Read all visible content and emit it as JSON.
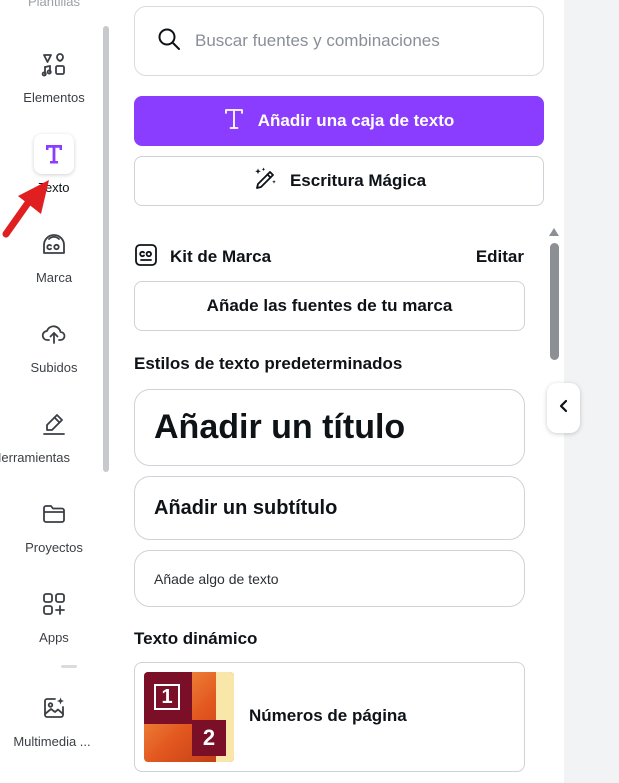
{
  "sidebar": {
    "top_partial_label": "Plantillas",
    "items": [
      {
        "label": "Elementos",
        "icon": "elements-icon"
      },
      {
        "label": "Texto",
        "icon": "text-icon"
      },
      {
        "label": "Marca",
        "icon": "brand-icon"
      },
      {
        "label": "Subidos",
        "icon": "upload-cloud-icon"
      },
      {
        "label": "Herramientas",
        "icon": "draw-tool-icon"
      },
      {
        "label": "Proyectos",
        "icon": "folder-icon"
      },
      {
        "label": "Apps",
        "icon": "apps-grid-icon"
      },
      {
        "label": "Multimedia ...",
        "icon": "magic-media-icon"
      }
    ],
    "active_index": 1,
    "accent_color": "#8b3dff"
  },
  "annotation": {
    "icon": "red-arrow-icon",
    "color": "#e02020"
  },
  "search": {
    "placeholder": "Buscar fuentes y combinaciones"
  },
  "actions": {
    "add_text_box": "Añadir una caja de texto",
    "magic_write": "Escritura Mágica"
  },
  "brand_kit": {
    "title": "Kit de Marca",
    "edit_label": "Editar",
    "add_fonts": "Añade las fuentes de tu marca"
  },
  "default_styles": {
    "heading": "Estilos de texto predeterminados",
    "title": "Añadir un título",
    "subtitle": "Añadir un subtítulo",
    "body": "Añade algo de texto"
  },
  "dynamic_text": {
    "heading": "Texto dinámico",
    "page_numbers": "Números de página",
    "thumb_num1": "1",
    "thumb_num2": "2"
  }
}
